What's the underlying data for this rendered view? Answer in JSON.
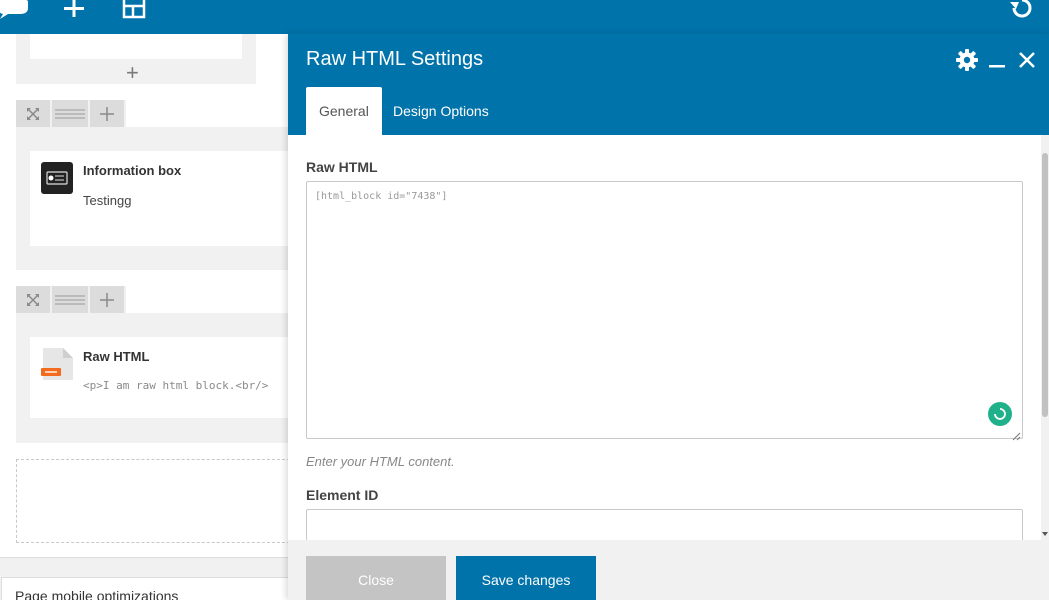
{
  "toolbar": {
    "icons": [
      "comment-icon",
      "plus-icon",
      "layout-icon",
      "undo-icon"
    ]
  },
  "canvas": {
    "elements": [
      {
        "title": "Information box",
        "subtitle": "Testingg",
        "icon": "info-box-icon"
      },
      {
        "title": "Raw HTML",
        "code": "<p>I am raw html block.<br/>",
        "icon": "html-file-icon"
      }
    ],
    "mobile_optimizations": "Page mobile optimizations"
  },
  "panel": {
    "title": "Raw HTML Settings",
    "tabs": [
      {
        "label": "General",
        "active": true
      },
      {
        "label": "Design Options",
        "active": false
      }
    ],
    "fields": {
      "raw_html_label": "Raw HTML",
      "raw_html_value": "[html_block id=\"7438\"]",
      "raw_html_help": "Enter your HTML content.",
      "element_id_label": "Element ID",
      "element_id_value": ""
    },
    "buttons": {
      "close": "Close",
      "save": "Save changes"
    }
  },
  "colors": {
    "brand": "#0073aa",
    "spinner": "#20b08a",
    "close_button": "#c4c4c4"
  }
}
